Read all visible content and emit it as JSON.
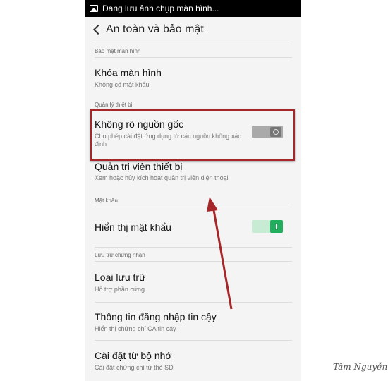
{
  "status_bar": {
    "notification": "Đang lưu ảnh chụp màn hình..."
  },
  "header": {
    "title": "An toàn và bảo mật"
  },
  "sections": {
    "screen_security": "Bảo mật màn hình",
    "device_admin": "Quản lý thiết bị",
    "password": "Mật khẩu",
    "credential_storage": "Lưu trữ chứng nhận"
  },
  "items": {
    "screen_lock": {
      "title": "Khóa màn hình",
      "subtitle": "Không có mật khẩu"
    },
    "unknown_sources": {
      "title": "Không rõ nguồn gốc",
      "subtitle": "Cho phép cài đặt ứng dụng từ các nguồn không xác định",
      "enabled": false
    },
    "device_admins": {
      "title": "Quản trị viên thiết bị",
      "subtitle": "Xem hoặc hủy kích hoạt quản trị viên điện thoại"
    },
    "show_password": {
      "title": "Hiển thị mật khẩu",
      "enabled": true
    },
    "storage_type": {
      "title": "Loại lưu trữ",
      "subtitle": "Hỗ trợ phần cứng"
    },
    "trusted_credentials": {
      "title": "Thông tin đăng nhập tin cậy",
      "subtitle": "Hiển thị chứng chỉ CA tin cậy"
    },
    "install_from_storage": {
      "title": "Cài đặt từ bộ nhớ",
      "subtitle": "Cài đặt chứng chỉ từ thẻ SD"
    }
  },
  "annotation": {
    "color": "#a6262a"
  },
  "watermark": {
    "text": "Tâm Nguyễn"
  }
}
